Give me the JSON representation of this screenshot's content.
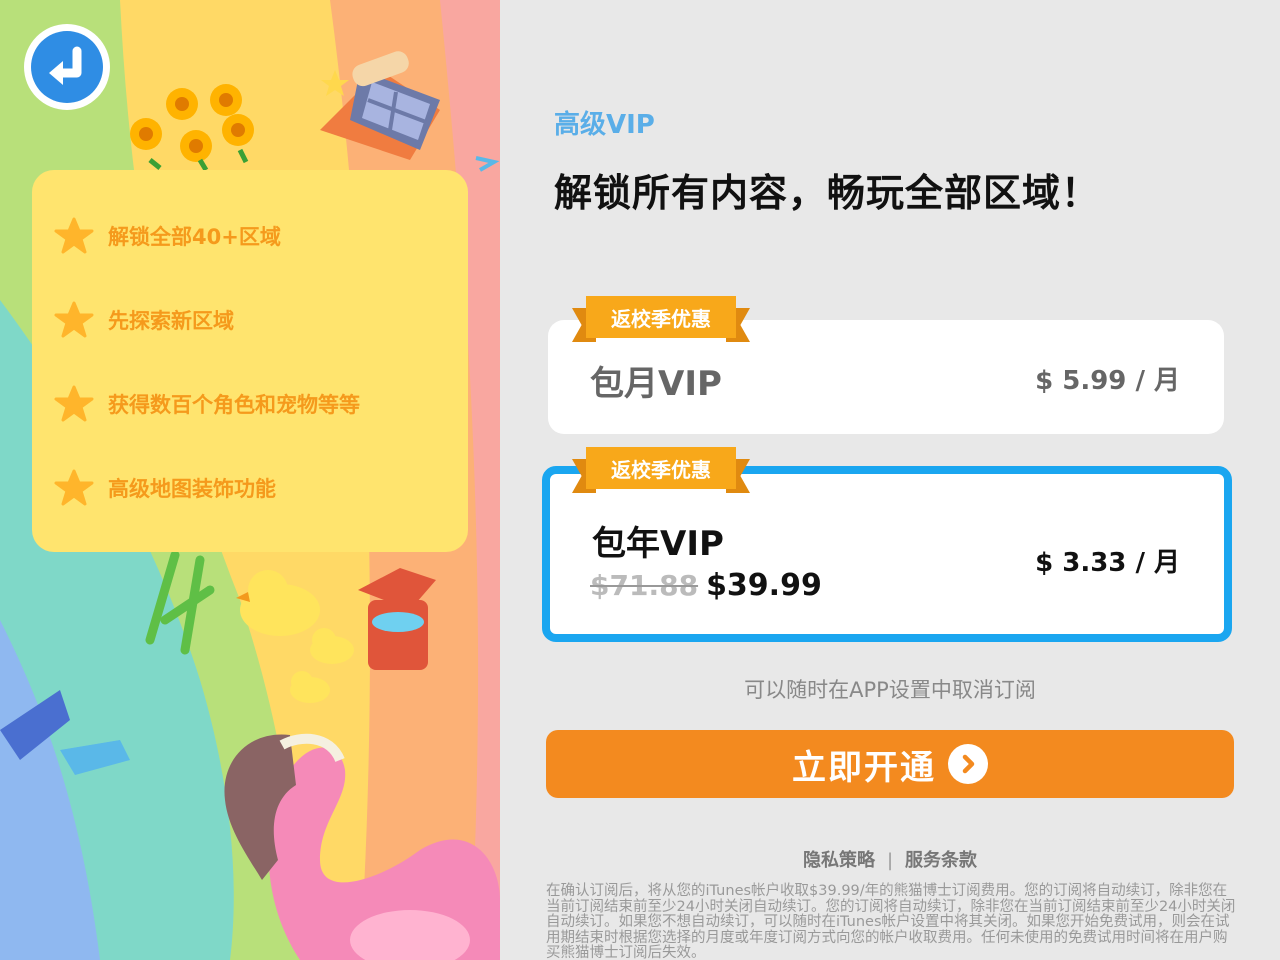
{
  "back_button": {
    "icon": "back-arrow-icon"
  },
  "features": [
    {
      "icon": "star-icon",
      "label": "解锁全部40+区域"
    },
    {
      "icon": "star-icon",
      "label": "先探索新区域"
    },
    {
      "icon": "star-icon",
      "label": "获得数百个角色和宠物等等"
    },
    {
      "icon": "star-icon",
      "label": "高级地图装饰功能"
    }
  ],
  "header": {
    "tier": "高级VIP",
    "headline": "解锁所有内容，畅玩全部区域！"
  },
  "plans": [
    {
      "promo": "返校季优惠",
      "name": "包月VIP",
      "price": "$ 5.99 / 月",
      "selected": false
    },
    {
      "promo": "返校季优惠",
      "name": "包年VIP",
      "old_price": "$71.88",
      "new_price": "$39.99",
      "price": "$ 3.33 / 月",
      "selected": true
    }
  ],
  "cancel_note": "可以随时在APP设置中取消订阅",
  "cta": {
    "label": "立即开通",
    "icon": "chevron-right-icon"
  },
  "legal": {
    "privacy": "隐私策略",
    "separator": "|",
    "terms": "服务条款",
    "fine_print": "在确认订阅后，将从您的iTunes帐户收取$39.99/年的熊猫博士订阅费用。您的订阅将自动续订，除非您在当前订阅结束前至少24小时关闭自动续订。您的订阅将自动续订，除非您在当前订阅结束前至少24小时关闭自动续订。如果您不想自动续订，可以随时在iTunes帐户设置中将其关闭。如果您开始免费试用，则会在试用期结束时根据您选择的月度或年度订阅方式向您的帐户收取费用。任何未使用的免费试用时间将在用户购买熊猫博士订阅后失效。"
  },
  "colors": {
    "accent_blue": "#1aa6f0",
    "tier_blue": "#5aaee8",
    "cta_orange": "#f38a1f",
    "promo_orange": "#f8a81a",
    "feature_text": "#f59a1c",
    "feature_card": "#ffe46e"
  }
}
